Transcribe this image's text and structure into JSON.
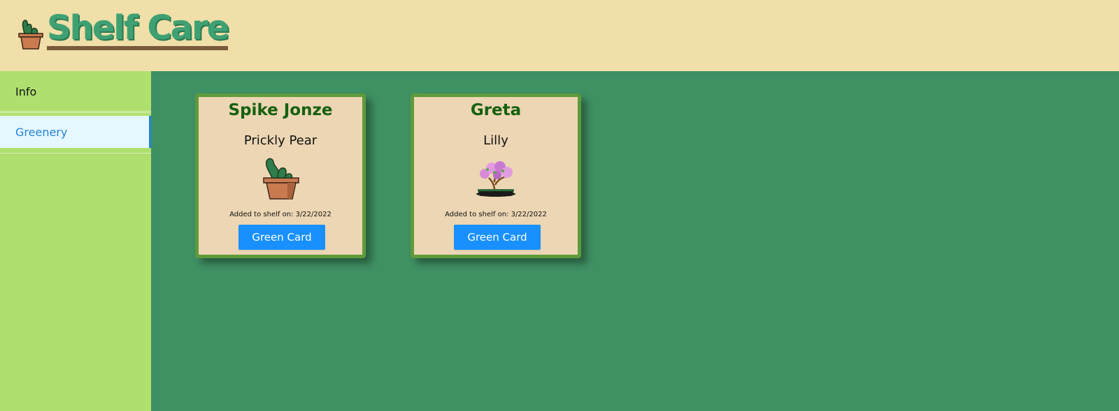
{
  "header": {
    "title": "Shelf Care",
    "logo_icon": "potted-cactus-icon"
  },
  "sidebar": {
    "items": [
      {
        "label": "Info",
        "selected": false
      },
      {
        "label": "Greenery",
        "selected": true
      }
    ]
  },
  "cards": [
    {
      "name": "Spike Jonze",
      "species": "Prickly Pear",
      "image_icon": "prickly-pear-cactus-icon",
      "added_text": "Added to shelf on: 3/22/2022",
      "button_label": "Green Card"
    },
    {
      "name": "Greta",
      "species": "Lilly",
      "image_icon": "flowering-bonsai-icon",
      "added_text": "Added to shelf on: 3/22/2022",
      "button_label": "Green Card"
    }
  ],
  "colors": {
    "header_bg": "#f0dfa8",
    "sidebar_bg": "#afe06f",
    "main_bg": "#3f9063",
    "card_bg": "#ecd6b4",
    "card_border": "#5e9b3a",
    "accent": "#1890ff",
    "title_green": "#3fa173"
  }
}
